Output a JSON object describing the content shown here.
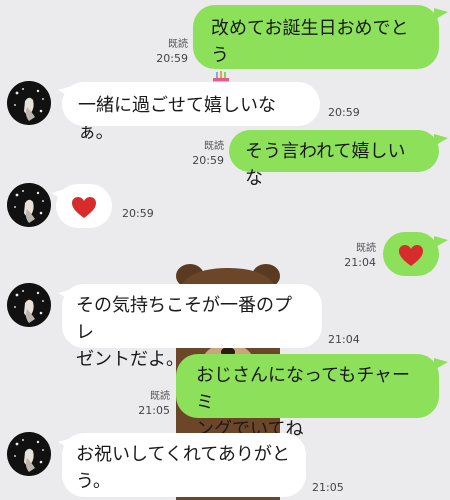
{
  "messages": [
    {
      "id": "m1",
      "side": "out",
      "text": "改めてお誕生日おめでとう",
      "read": "既読",
      "time": "20:59",
      "emoji": "cake"
    },
    {
      "id": "m2",
      "side": "in",
      "text": "一緒に過ごせて嬉しいなぁ。",
      "time": "20:59"
    },
    {
      "id": "m3",
      "side": "out",
      "text": "そう言われて嬉しいな",
      "read": "既読",
      "time": "20:59"
    },
    {
      "id": "m4",
      "side": "in",
      "text": "",
      "time": "20:59",
      "emoji": "heart"
    },
    {
      "id": "m5",
      "side": "out",
      "text": "",
      "read": "既読",
      "time": "21:04",
      "emoji": "heart"
    },
    {
      "id": "m6",
      "side": "in",
      "line1": "その気持ちこそが一番のプレ",
      "line2": "ゼントだよ。",
      "time": "21:04"
    },
    {
      "id": "m7",
      "side": "out",
      "line1": "おじさんになってもチャーミ",
      "line2": "ングでいてね",
      "read": "既読",
      "time": "21:05"
    },
    {
      "id": "m8",
      "side": "in",
      "line1": "お祝いしてくれてありがと",
      "line2": "う。",
      "time": "21:05"
    }
  ],
  "colors": {
    "outgoing_bubble": "#8de05a",
    "incoming_bubble": "#ffffff",
    "background": "#ebebed",
    "heart": "#d82c2c"
  },
  "icons": {
    "heart": "heart-emoji",
    "cake": "birthday-cake-emoji",
    "avatar": "contact-avatar"
  }
}
